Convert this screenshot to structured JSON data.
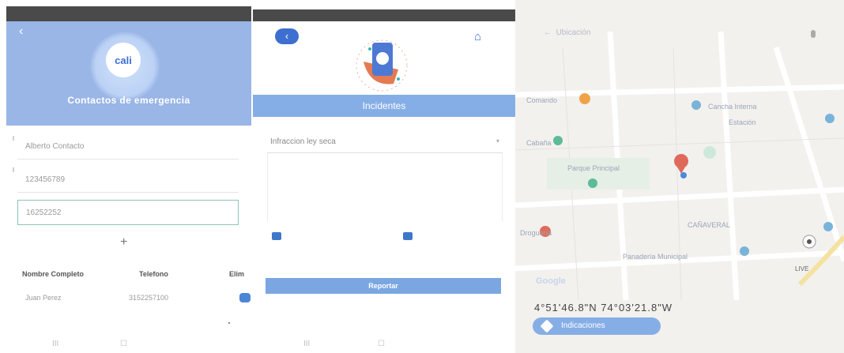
{
  "contacts_screen": {
    "back_icon": "back-arrow-icon",
    "logo_text": "cali",
    "title": "Contactos de emergencia",
    "name_field_value": "Alberto Contacto",
    "phone_field_value": "123456789",
    "active_field_value": "16252252",
    "add_label": "+",
    "table": {
      "headers": [
        "Nombre Completo",
        "Telefono",
        "Elim"
      ],
      "rows": [
        {
          "name": "Juan Perez",
          "phone": "3152257100"
        }
      ]
    },
    "nav_icons": [
      "III",
      "☐"
    ]
  },
  "incidents_screen": {
    "back_icon": "back-circle-icon",
    "home_icon": "home-icon",
    "banner_title": "Incidentes",
    "incident_type_value": "Infraccion ley seca",
    "report_button": "Reportar",
    "nav_icons": [
      "III",
      "☐"
    ]
  },
  "map_screen": {
    "search_text": "Ubicación",
    "labels": [
      "Cancha Interna",
      "Parque Principal",
      "CAÑAVERAL",
      "Comando",
      "Estación",
      "Panadería Municipal",
      "Cabaña",
      "Droguería"
    ],
    "google_label": "Google",
    "coordinates": "4°51'46.8\"N 74°03'21.8\"W",
    "directions_button": "Indicaciones",
    "live_label": "LIVE",
    "accent_colors": {
      "primary_blue": "#86aee6",
      "pin_red": "#e06a5a",
      "pin_green": "#5dbb9a",
      "pin_orange": "#f0a24a"
    }
  }
}
